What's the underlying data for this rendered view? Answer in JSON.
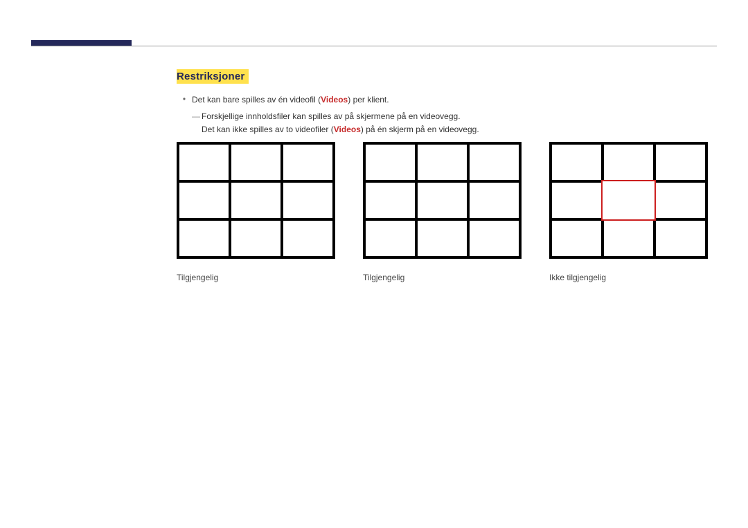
{
  "section": {
    "heading": "Restriksjoner"
  },
  "bullet": {
    "line1_pre": "Det kan bare spilles av én videofil (",
    "videos_label": "Videos",
    "line1_post": ") per klient."
  },
  "sub": {
    "line1": "Forskjellige innholdsfiler kan spilles av på skjermene på en videovegg.",
    "line2_pre": "Det kan ikke spilles av to videofiler (",
    "videos_label": "Videos",
    "line2_post": ") på én skjerm på en videovegg."
  },
  "captions": {
    "g1": "Tilgjengelig",
    "g2": "Tilgjengelig",
    "g3": "Ikke tilgjengelig"
  }
}
